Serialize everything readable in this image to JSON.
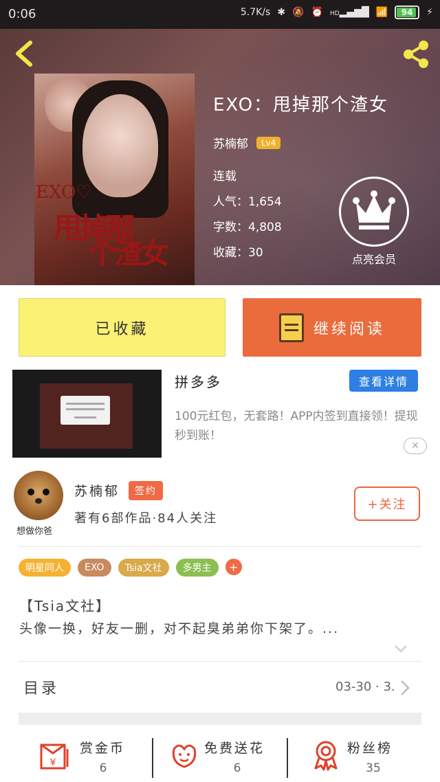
{
  "status_bar": {
    "time": "0:06",
    "net_speed": "5.7K/s",
    "signal_label": "HD",
    "battery": "94",
    "battery_level": 0.94
  },
  "book": {
    "title": "EXO：甩掉那个渣女",
    "author": "苏楠郁",
    "author_level": "Lv4",
    "status": "连载",
    "popularity": "人气：1,654",
    "word_count": "字数：4,808",
    "favorites": "收藏：30"
  },
  "cover": {
    "exo": "EXO♡",
    "title_line1": "甩掉那",
    "title_line2": "个渣女"
  },
  "vip": {
    "label": "点亮会员"
  },
  "actions": {
    "favorited_label": "已收藏",
    "continue_label": "继续阅读"
  },
  "ad": {
    "title": "拼多多",
    "detail_button": "查看详情",
    "description": "100元红包，无套路！APP内签到直接领！提现秒到账！",
    "close": "✕"
  },
  "author_card": {
    "name": "苏楠郁",
    "badge": "签约",
    "info": "著有6部作品·84人关注",
    "follow_button": "+关注",
    "avatar_caption": "想做你爸"
  },
  "tags": [
    {
      "label": "明星同人",
      "color": "#f5b232"
    },
    {
      "label": "EXO",
      "color": "#c98a5e"
    },
    {
      "label": "Tsia文社",
      "color": "#d9a94a"
    },
    {
      "label": "多男主",
      "color": "#8cbf52"
    }
  ],
  "tag_more": "+",
  "summary": {
    "heading": "【Tsia文社】",
    "text": "头像一换，好友一删，对不起臭弟弟你下架了。..."
  },
  "toc": {
    "label": "目录",
    "date": "03-30 · 3."
  },
  "bottom_bar": [
    {
      "label": "赏金币",
      "count": "6",
      "icon": "reward-coin-icon"
    },
    {
      "label": "免费送花",
      "count": "6",
      "icon": "flower-icon"
    },
    {
      "label": "粉丝榜",
      "count": "35",
      "icon": "ribbon-badge-icon"
    }
  ],
  "colors": {
    "accent": "#ea6b3c",
    "fav_button": "#fbf275",
    "detail_blue": "#2d7fe3",
    "header_bg": "#6a4a52"
  }
}
